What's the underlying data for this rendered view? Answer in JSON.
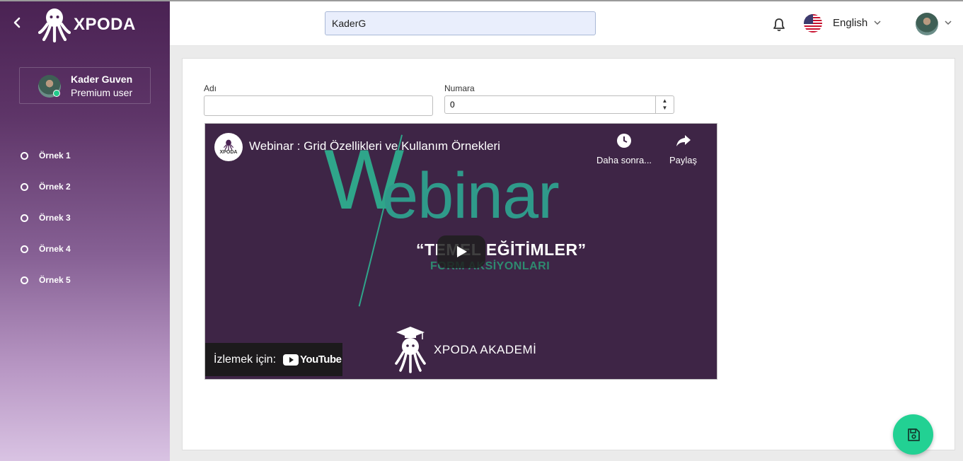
{
  "app": {
    "brand": "XPODA"
  },
  "user": {
    "name": "Kader Guven",
    "role": "Premium user"
  },
  "sidebar": {
    "items": [
      {
        "label": "Örnek 1"
      },
      {
        "label": "Örnek 2"
      },
      {
        "label": "Örnek 3"
      },
      {
        "label": "Örnek 4"
      },
      {
        "label": "Örnek 5"
      }
    ]
  },
  "header": {
    "search_value": "KaderG",
    "language": "English"
  },
  "form": {
    "name_label": "Adı",
    "name_value": "",
    "number_label": "Numara",
    "number_value": "0"
  },
  "video": {
    "channel_logo_text": "XPODA",
    "title": "Webinar : Grid Özellikleri ve Kullanım Örnekleri",
    "watch_later": "Daha sonra...",
    "share": "Paylaş",
    "thumb_word_first": "W",
    "thumb_word_rest": "ebinar",
    "thumb_title": "“TEMEL EĞİTİMLER”",
    "thumb_subtitle": "FORM AKSİYONLARI",
    "thumb_brand": "XPODA AKADEMİ",
    "watch_on": "İzlemek için:",
    "youtube": "YouTube"
  },
  "colors": {
    "accent": "#22d193",
    "sidebar_top": "#4a2253",
    "sidebar_bottom": "#d9c3e3"
  }
}
